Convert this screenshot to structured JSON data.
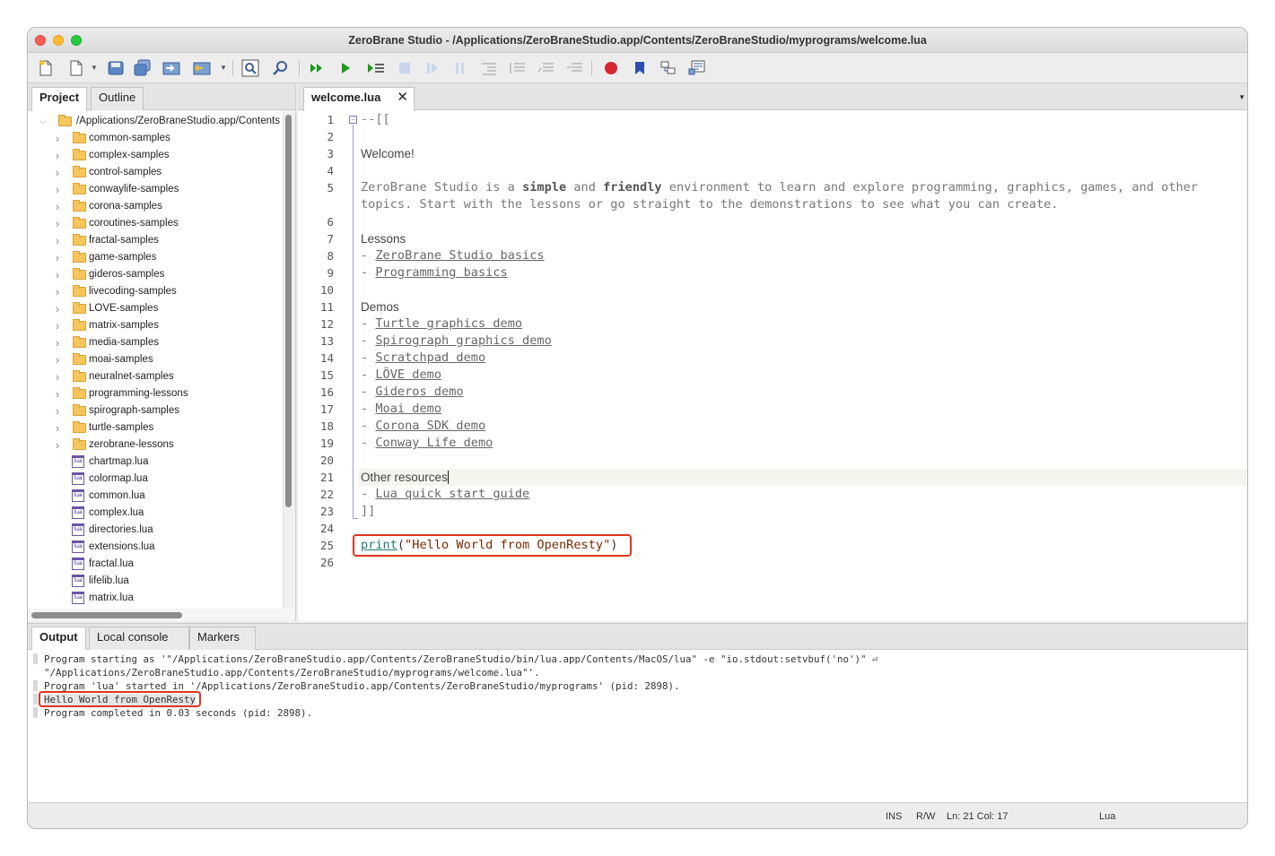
{
  "window": {
    "title": "ZeroBrane Studio - /Applications/ZeroBraneStudio.app/Contents/ZeroBraneStudio/myprograms/welcome.lua"
  },
  "toolbar": {
    "icons": [
      "new-file-icon",
      "new-dropdown-icon",
      "save-icon",
      "save-all-icon",
      "project-directory-icon",
      "project-choose-icon",
      "find-icon",
      "find-in-files-icon",
      "run-icon",
      "start-debug-icon",
      "run-to-cursor-icon",
      "stop-icon",
      "step-over-icon",
      "break-icon",
      "step-into-icon",
      "step-out-icon",
      "watch-icon",
      "stack-icon",
      "breakpoint-icon",
      "bookmark-icon",
      "compile-icon",
      "analyze-icon"
    ]
  },
  "left_panel": {
    "tabs": [
      {
        "label": "Project",
        "active": true
      },
      {
        "label": "Outline",
        "active": false
      }
    ],
    "root": "/Applications/ZeroBraneStudio.app/Contents",
    "folders": [
      "common-samples",
      "complex-samples",
      "control-samples",
      "conwaylife-samples",
      "corona-samples",
      "coroutines-samples",
      "fractal-samples",
      "game-samples",
      "gideros-samples",
      "livecoding-samples",
      "LOVE-samples",
      "matrix-samples",
      "media-samples",
      "moai-samples",
      "neuralnet-samples",
      "programming-lessons",
      "spirograph-samples",
      "turtle-samples",
      "zerobrane-lessons"
    ],
    "files": [
      "chartmap.lua",
      "colormap.lua",
      "common.lua",
      "complex.lua",
      "directories.lua",
      "extensions.lua",
      "fractal.lua",
      "lifelib.lua",
      "matrix.lua"
    ],
    "file_icon_text": "lua"
  },
  "editor": {
    "tab_label": "welcome.lua",
    "tab_close": "✕",
    "lines": [
      {
        "n": "1",
        "text": "--[["
      },
      {
        "n": "2",
        "text": ""
      },
      {
        "n": "3",
        "text": "Welcome!"
      },
      {
        "n": "4",
        "text": ""
      },
      {
        "n": "5a",
        "text_before": "ZeroBrane Studio is a ",
        "bold1": "simple",
        "mid": " and ",
        "bold2": "friendly",
        "text_after": " environment to learn and explore programming, graphics, games, and other"
      },
      {
        "n": "5b",
        "text": "topics. Start with the lessons or go straight to the demonstrations to see what you can create."
      },
      {
        "n": "6",
        "text": ""
      },
      {
        "n": "7",
        "text": "Lessons"
      },
      {
        "n": "8",
        "prefix": "- ",
        "link": "ZeroBrane Studio basics"
      },
      {
        "n": "9",
        "prefix": "- ",
        "link": "Programming basics"
      },
      {
        "n": "10",
        "text": ""
      },
      {
        "n": "11",
        "text": "Demos"
      },
      {
        "n": "12",
        "prefix": "- ",
        "link": "Turtle graphics demo"
      },
      {
        "n": "13",
        "prefix": "- ",
        "link": "Spirograph graphics demo"
      },
      {
        "n": "14",
        "prefix": "- ",
        "link": "Scratchpad demo"
      },
      {
        "n": "15",
        "prefix": "- ",
        "link": "LÖVE demo"
      },
      {
        "n": "16",
        "prefix": "- ",
        "link": "Gideros demo"
      },
      {
        "n": "17",
        "prefix": "- ",
        "link": "Moai demo"
      },
      {
        "n": "18",
        "prefix": "- ",
        "link": "Corona SDK demo"
      },
      {
        "n": "19",
        "prefix": "- ",
        "link": "Conway Life demo"
      },
      {
        "n": "20",
        "text": ""
      },
      {
        "n": "21",
        "text": "Other resources"
      },
      {
        "n": "22",
        "prefix": "- ",
        "link": "Lua quick start guide"
      },
      {
        "n": "23",
        "text": "]]"
      },
      {
        "n": "24",
        "text": ""
      },
      {
        "n": "25",
        "fn": "print",
        "open": "(",
        "str": "\"Hello World from OpenResty\"",
        "close": ")"
      },
      {
        "n": "26",
        "text": ""
      }
    ]
  },
  "output": {
    "tabs": [
      {
        "label": "Output",
        "active": true
      },
      {
        "label": "Local console",
        "active": false
      },
      {
        "label": "Markers",
        "active": false
      }
    ],
    "lines": [
      "Program starting as '\"/Applications/ZeroBraneStudio.app/Contents/ZeroBraneStudio/bin/lua.app/Contents/MacOS/lua\" -e \"io.stdout:setvbuf('no')\" ",
      "\"/Applications/ZeroBraneStudio.app/Contents/ZeroBraneStudio/myprograms/welcome.lua\"'.",
      "Program 'lua' started in '/Applications/ZeroBraneStudio.app/Contents/ZeroBraneStudio/myprograms' (pid: 2898).",
      "Hello World from OpenResty",
      "Program completed in 0.03 seconds (pid: 2898)."
    ],
    "wrap_glyph": "⏎"
  },
  "status": {
    "mode": "INS",
    "access": "R/W",
    "position": "Ln: 21 Col: 17",
    "language": "Lua"
  },
  "colors": {
    "highlight_box": "#e0341c",
    "folder": "#f6c55c",
    "lua_icon": "#6a55a8"
  }
}
